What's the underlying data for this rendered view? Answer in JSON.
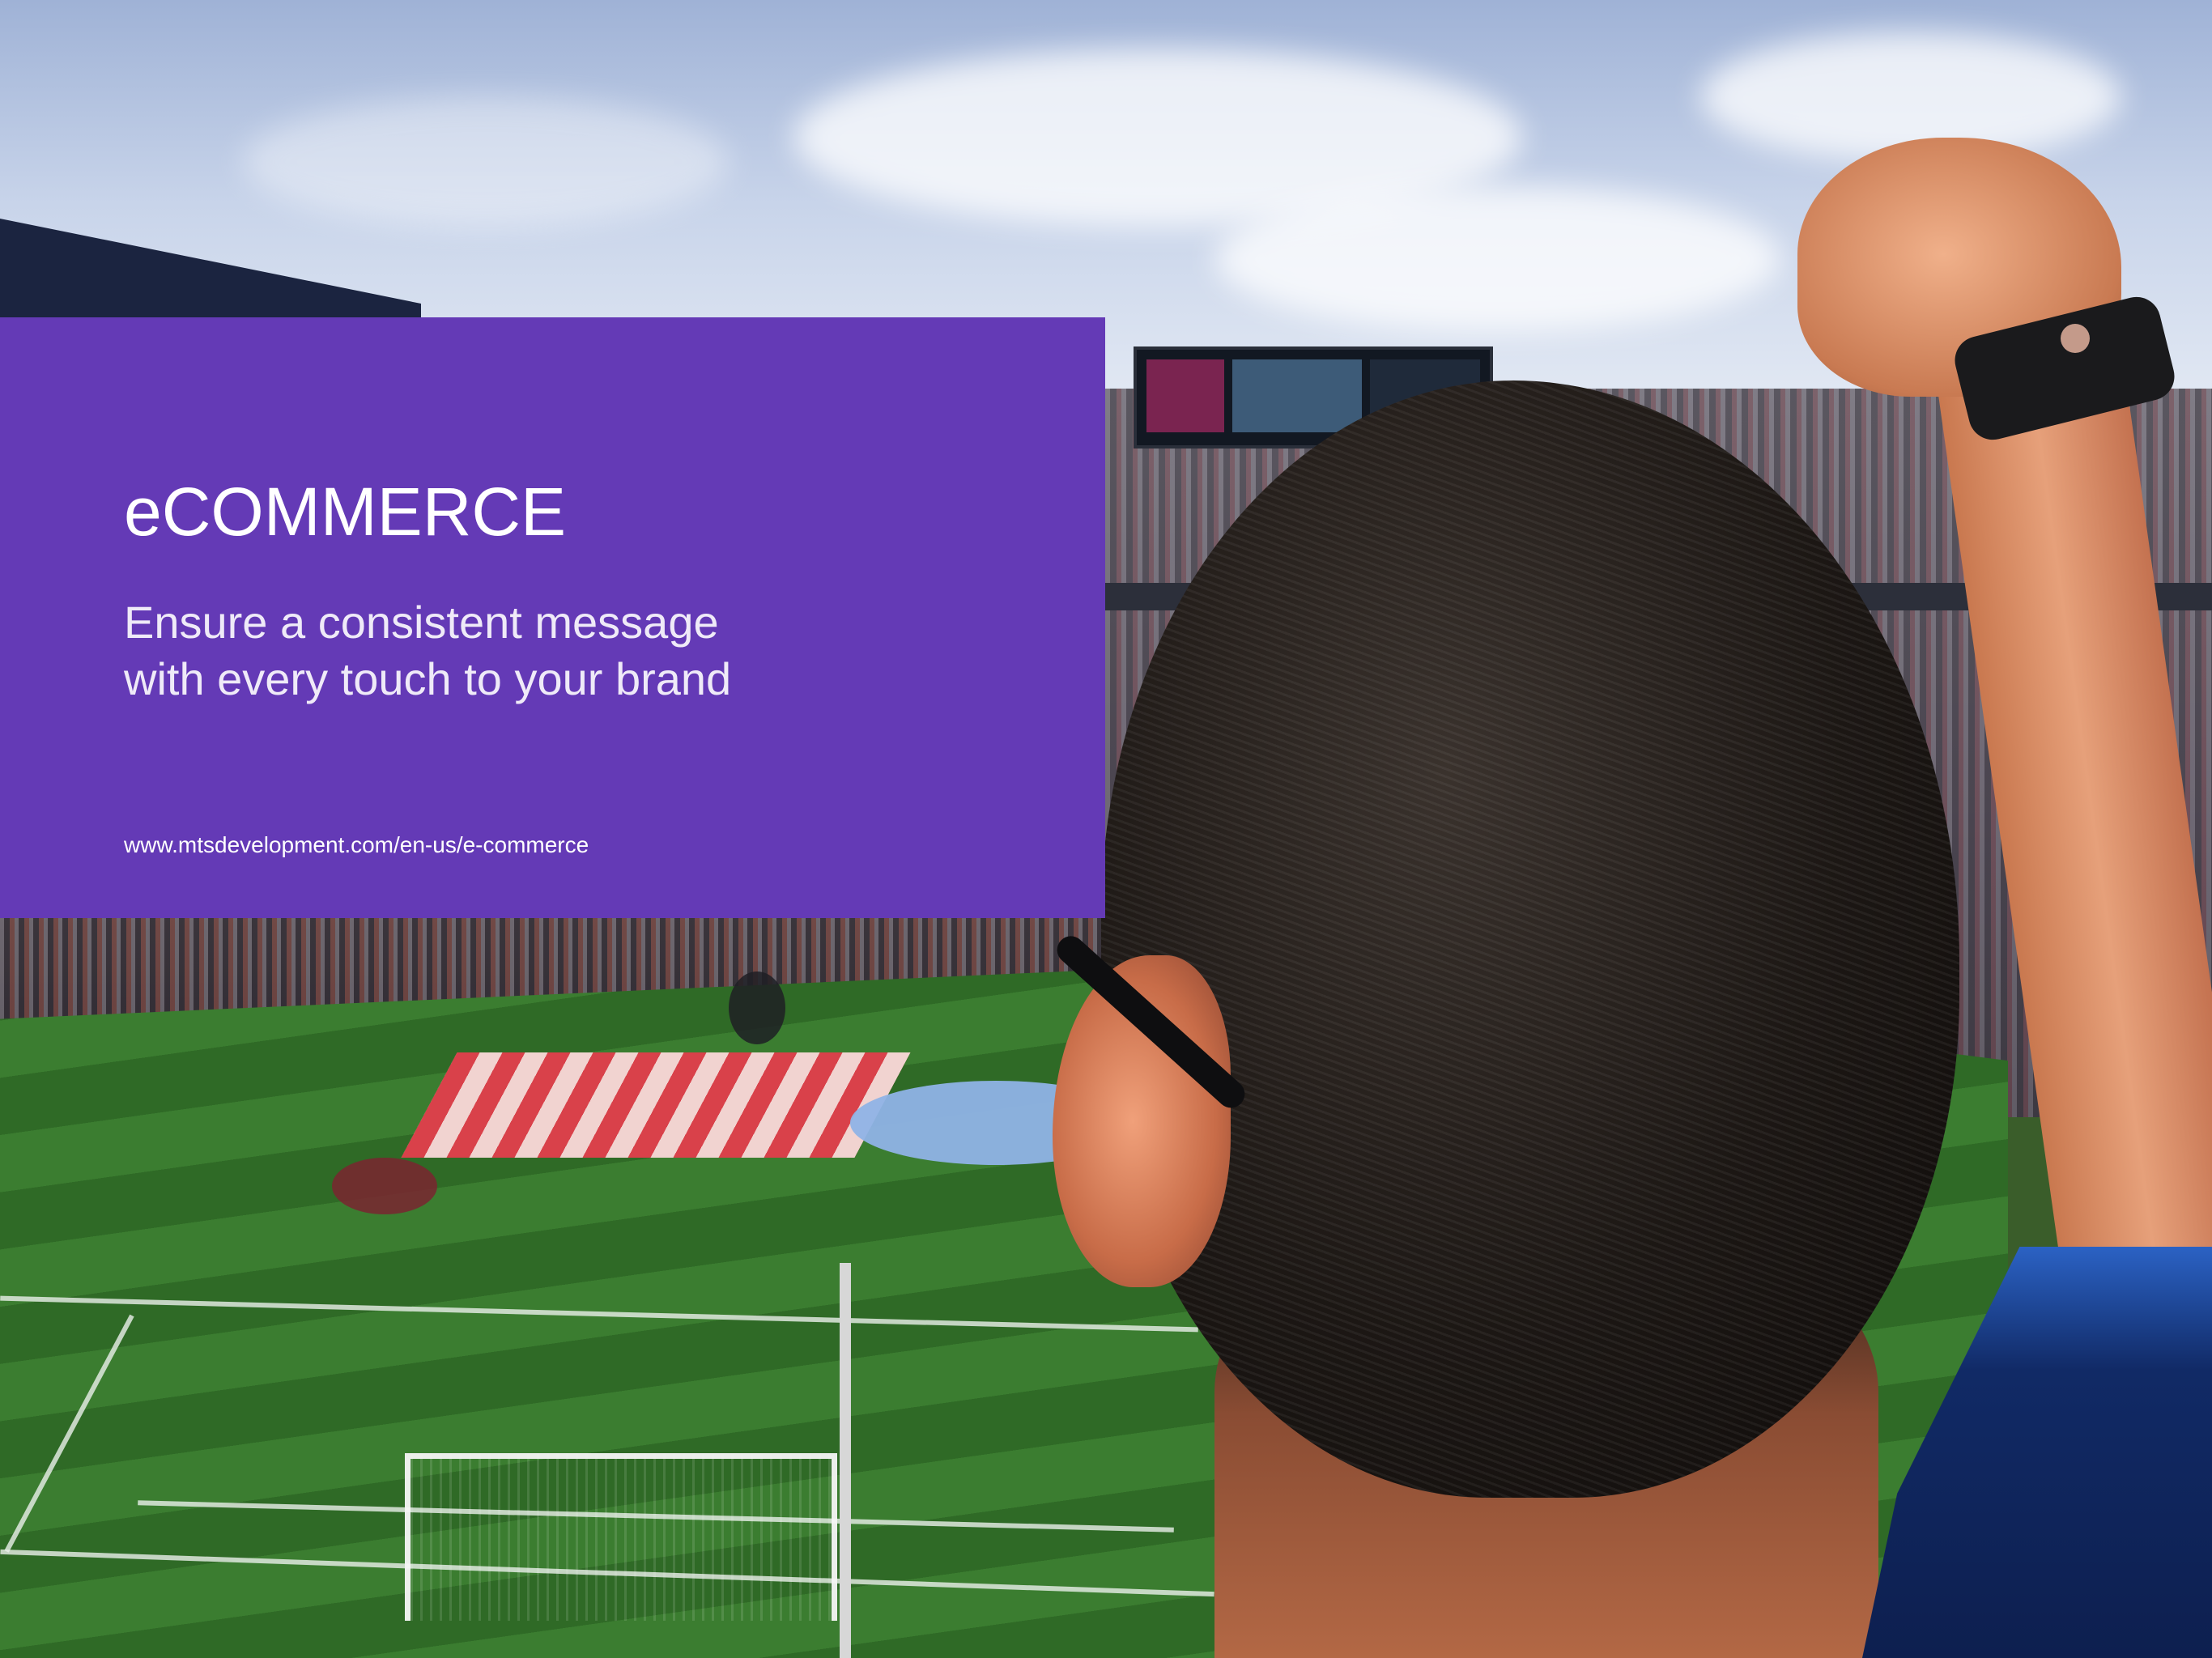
{
  "hero": {
    "title": "eCOMMERCE",
    "subtitle_lines": [
      "Ensure a consistent message",
      "with every touch to your brand"
    ],
    "url": "www.mtsdevelopment.com/en-us/e-commerce"
  },
  "colors": {
    "panel": "#643ab6",
    "text": "#ffffff"
  },
  "background_image": {
    "icon": "stadium-fan-photo"
  }
}
